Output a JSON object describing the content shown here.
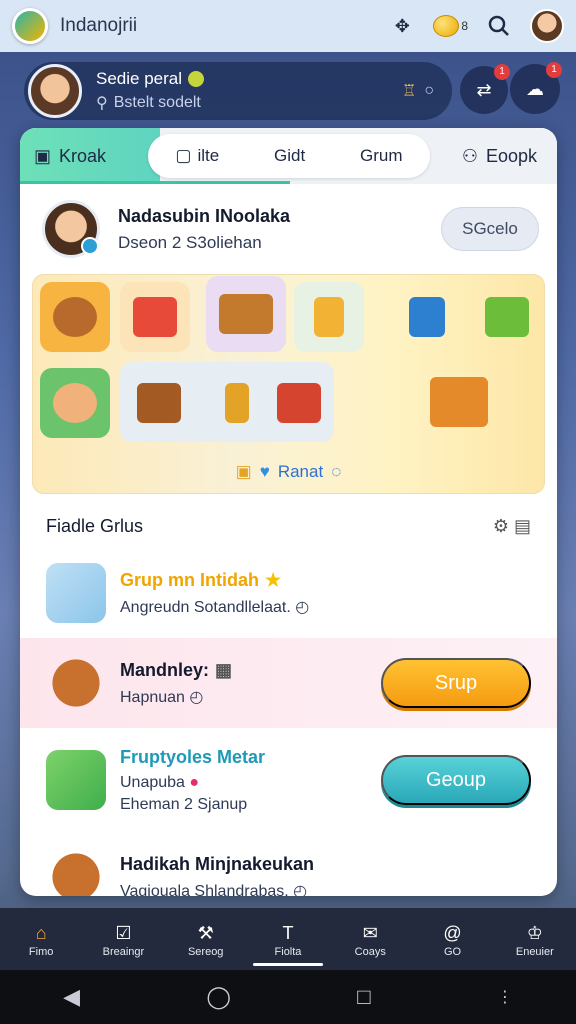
{
  "app": {
    "title": "Indanojrii",
    "coins_label": "8"
  },
  "profile": {
    "name": "Sedie peral",
    "search": "Bstelt sodelt"
  },
  "header_badges": {
    "btn1": "1",
    "btn2": "1"
  },
  "tabs": {
    "left": "Kroak",
    "seg1": "ilte",
    "seg2": "Gidt",
    "seg3": "Grum",
    "right": "Eoopk"
  },
  "user": {
    "name": "Nadasubin INoolaka",
    "sub": "Dseon 2 S3oliehan",
    "button": "SGcelo"
  },
  "gift_panel": {
    "reward_label": "Ranat"
  },
  "groups": {
    "title": "Fiadle Grlus",
    "items": [
      {
        "title": "Grup mn Intidah",
        "sub": "Angreudn Sotandllelaat.",
        "button": ""
      },
      {
        "title": "Mandnley:",
        "sub": "Hapnuan",
        "button": "Srup"
      },
      {
        "title": "Fruptyoles Metar",
        "sub": "Unapuba",
        "sub2": "Eheman 2 Sjanup",
        "button": "Geoup"
      },
      {
        "title": "Hadikah Minjnakeukan",
        "sub": "Vagiouala Shlandrabas.",
        "button": ""
      }
    ]
  },
  "bottom_nav": [
    "Fimo",
    "Breaingr",
    "Sereog",
    "Fiolta",
    "Coays",
    "GO",
    "Eneuier"
  ],
  "colors": {
    "accent": "#37c6a3",
    "orange": "#f59b10",
    "teal": "#2aa8b8"
  }
}
